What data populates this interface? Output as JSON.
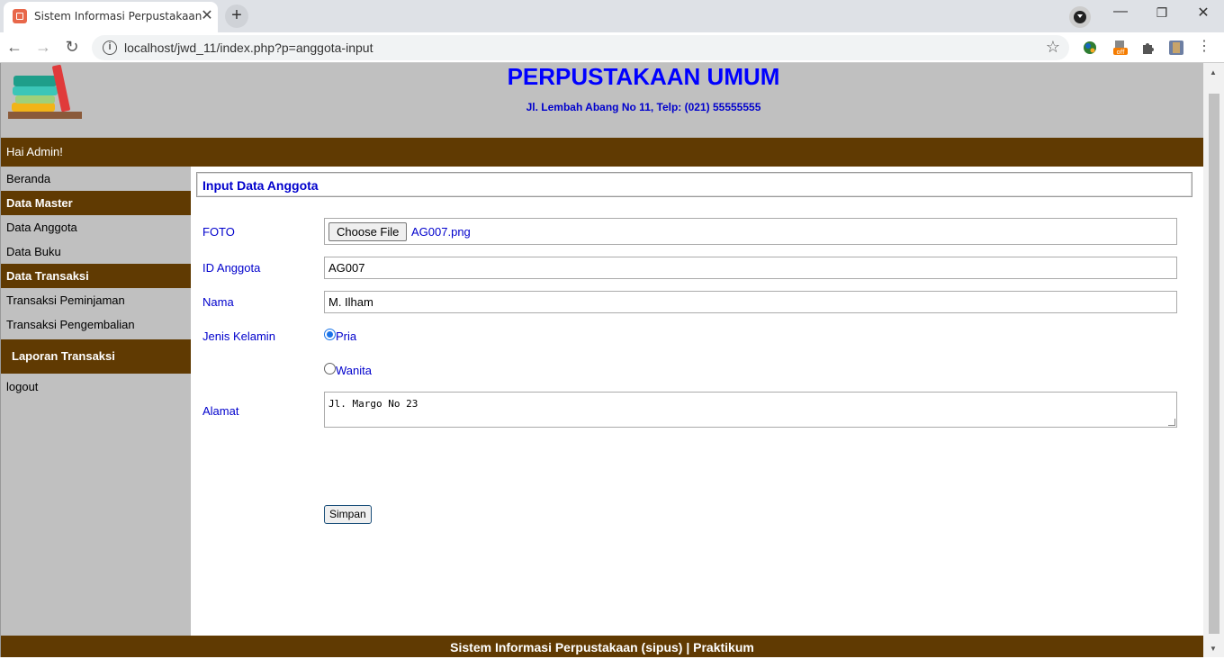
{
  "browser": {
    "tab_title": "Sistem Informasi Perpustakaan",
    "url": "localhost/jwd_11/index.php?p=anggota-input",
    "icons": [
      "back-icon",
      "forward-icon",
      "reload-icon",
      "info-icon",
      "star-icon",
      "extensions-icon"
    ]
  },
  "header": {
    "title": "PERPUSTAKAAN UMUM",
    "address": "Jl. Lembah Abang No 11, Telp: (021) 55555555"
  },
  "greeting": "Hai Admin!",
  "sidebar": {
    "items": [
      {
        "label": "Beranda",
        "type": "item"
      },
      {
        "label": "Data Master",
        "type": "head"
      },
      {
        "label": "Data Anggota",
        "type": "item"
      },
      {
        "label": "Data Buku",
        "type": "item"
      },
      {
        "label": "Data Transaksi",
        "type": "head"
      },
      {
        "label": "Transaksi Peminjaman",
        "type": "item"
      },
      {
        "label": "Transaksi Pengembalian",
        "type": "item"
      },
      {
        "label": "Laporan Transaksi",
        "type": "head"
      },
      {
        "label": "logout",
        "type": "item"
      }
    ]
  },
  "form": {
    "title": "Input Data Anggota",
    "foto_label": "FOTO",
    "choose_file": "Choose File",
    "file_name": "AG007.png",
    "id_label": "ID Anggota",
    "id_value": "AG007",
    "nama_label": "Nama",
    "nama_value": "M. Ilham",
    "jk_label": "Jenis Kelamin",
    "jk_options": [
      "Pria",
      "Wanita"
    ],
    "jk_selected": "Pria",
    "alamat_label": "Alamat",
    "alamat_value": "Jl. Margo No 23",
    "submit": "Simpan"
  },
  "footer": "Sistem Informasi Perpustakaan (sipus) | Praktikum",
  "colors": {
    "brown": "#603a02",
    "gray": "#c0c0c0",
    "label_blue": "#0000cc",
    "title_blue": "#0000ff"
  }
}
